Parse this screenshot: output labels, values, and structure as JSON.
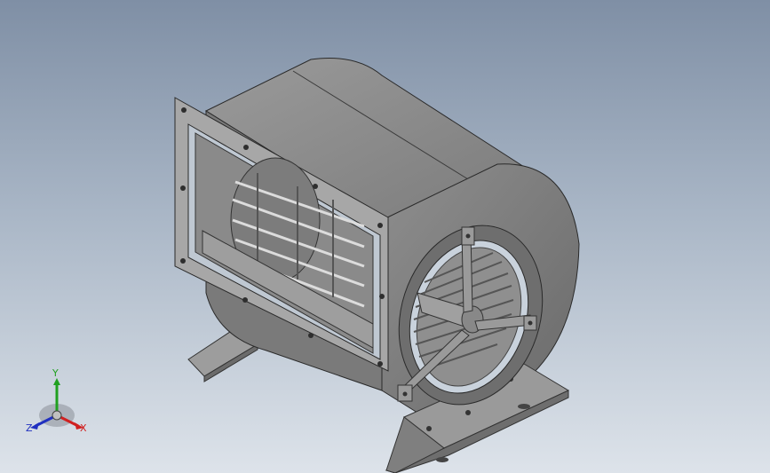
{
  "viewport": {
    "background_top": "#7f8fa5",
    "background_bottom": "#dde3ea"
  },
  "model": {
    "body_color": "#8a8a8a",
    "dark_color": "#5a5a5a",
    "edge_color": "#2a2a2a"
  },
  "triad": {
    "x_label": "X",
    "y_label": "Y",
    "z_label": "Z",
    "x_color": "#d02020",
    "y_color": "#20a020",
    "z_color": "#2030c0"
  }
}
